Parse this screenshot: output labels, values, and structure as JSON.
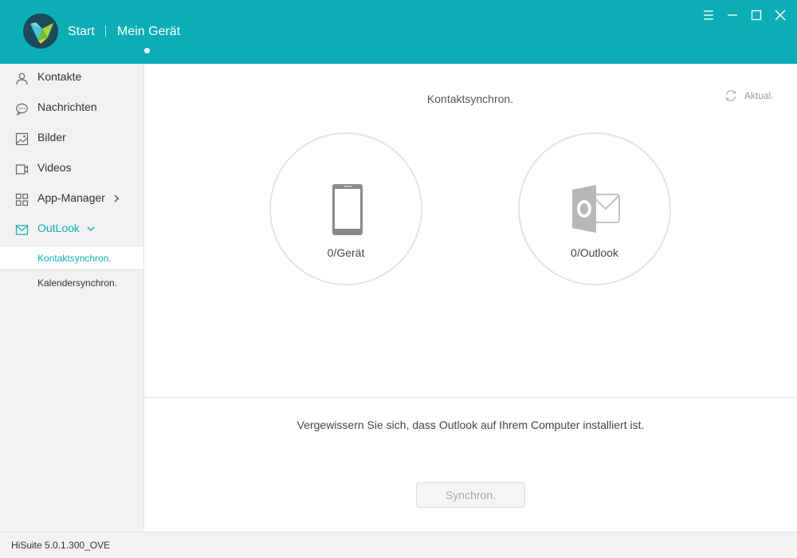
{
  "header": {
    "nav_start": "Start",
    "nav_device": "Mein Gerät",
    "brand_color": "#0caeb6"
  },
  "window_controls": {
    "menu_icon": "menu-icon",
    "maximize_icon": "maximize-icon",
    "close_icon": "close-icon"
  },
  "sidebar": {
    "items": [
      {
        "label": "Kontakte",
        "icon": "person-icon"
      },
      {
        "label": "Nachrichten",
        "icon": "chat-bubble-icon"
      },
      {
        "label": "Bilder",
        "icon": "image-icon"
      },
      {
        "label": "Videos",
        "icon": "video-icon"
      },
      {
        "label": "App-Manager",
        "icon": "grid-icon"
      },
      {
        "label": "OutLook",
        "icon": "mail-icon"
      }
    ],
    "subitems": [
      {
        "label": "Kontaktsynchron."
      },
      {
        "label": "Kalendersynchron."
      }
    ]
  },
  "main": {
    "title": "Kontaktsynchron.",
    "refresh_label": "Aktual.",
    "device_label": "0/Gerät",
    "outlook_label": "0/Outlook",
    "info_text": "Vergewissern Sie sich, dass Outlook auf Ihrem Computer installiert ist.",
    "sync_button": "Synchron."
  },
  "footer": {
    "version": "HiSuite 5.0.1.300_OVE"
  }
}
